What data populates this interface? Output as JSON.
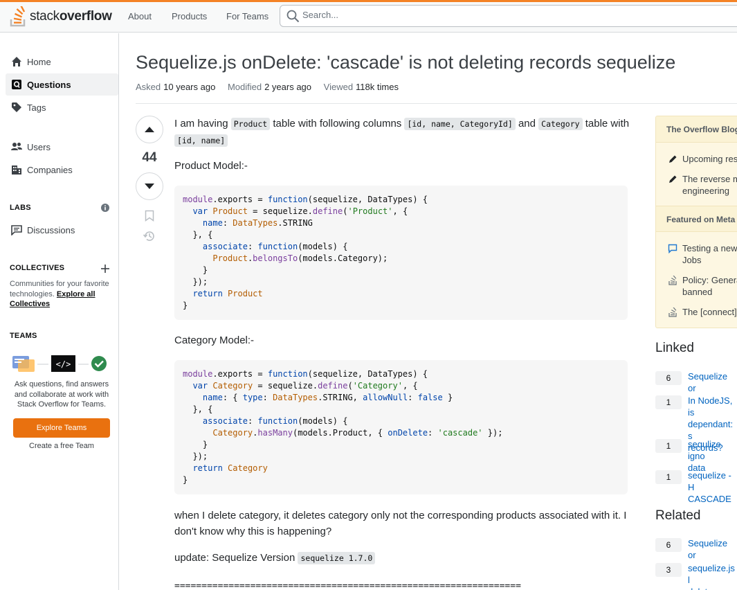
{
  "header": {
    "logo_text_light": "stack",
    "logo_text_bold": "overflow",
    "nav": [
      "About",
      "Products",
      "For Teams"
    ],
    "search_placeholder": "Search..."
  },
  "sidebar": {
    "home": "Home",
    "questions": "Questions",
    "tags": "Tags",
    "users": "Users",
    "companies": "Companies",
    "labs_heading": "LABS",
    "discussions": "Discussions",
    "collectives_heading": "COLLECTIVES",
    "collectives_text": "Communities for your favorite technologies.",
    "collectives_link": "Explore all Collectives",
    "teams_heading": "TEAMS",
    "teams_text": "Ask questions, find answers and collaborate at work with Stack Overflow for Teams.",
    "explore_teams": "Explore Teams",
    "create_team": "Create a free Team"
  },
  "question": {
    "title": "Sequelize.js onDelete: 'cascade' is not deleting records sequelize",
    "asked_label": "Asked",
    "asked_value": "10 years ago",
    "modified_label": "Modified",
    "modified_value": "2 years ago",
    "viewed_label": "Viewed",
    "viewed_value": "118k times",
    "votes": "44",
    "body": {
      "p1_a": "I am having ",
      "p1_code1": "Product",
      "p1_b": " table with following columns ",
      "p1_code2": "[id, name, CategoryId]",
      "p1_c": " and ",
      "p1_code3": "Category",
      "p1_d": " table with ",
      "p1_code4": "[id, name]",
      "product_model": "Product Model:-",
      "category_model": "Category Model:-",
      "p2": "when I delete category, it deletes category only not the corresponding products associated with it. I don't know why this is happening?",
      "p3_a": "update: Sequelize Version ",
      "p3_code": "sequelize 1.7.0",
      "separator": "================================================================"
    }
  },
  "right": {
    "blog_heading": "The Overflow Blog",
    "blog_items": [
      "Upcoming res",
      "The reverse m\nengineering"
    ],
    "meta_heading": "Featured on Meta",
    "meta_items": [
      "Testing a new\nJobs",
      "Policy: Genera\nbanned",
      "The [connect]"
    ],
    "linked_heading": "Linked",
    "linked": [
      {
        "count": "6",
        "text": "Sequelize or"
      },
      {
        "count": "1",
        "text": "In NodeJS, is\ndependant: s\nrecords?"
      },
      {
        "count": "1",
        "text": "sequlize igno\ndata"
      },
      {
        "count": "1",
        "text": "sequelize - H\nCASCADE"
      }
    ],
    "related_heading": "Related",
    "related": [
      {
        "count": "6",
        "text": "Sequelize or"
      },
      {
        "count": "3",
        "text": "sequelize.js l\ndelete casca"
      }
    ]
  },
  "colors": {
    "accent": "#f48225",
    "button": "#e9710f",
    "link": "#0063bf",
    "blog_bg": "#fdf7e2"
  }
}
